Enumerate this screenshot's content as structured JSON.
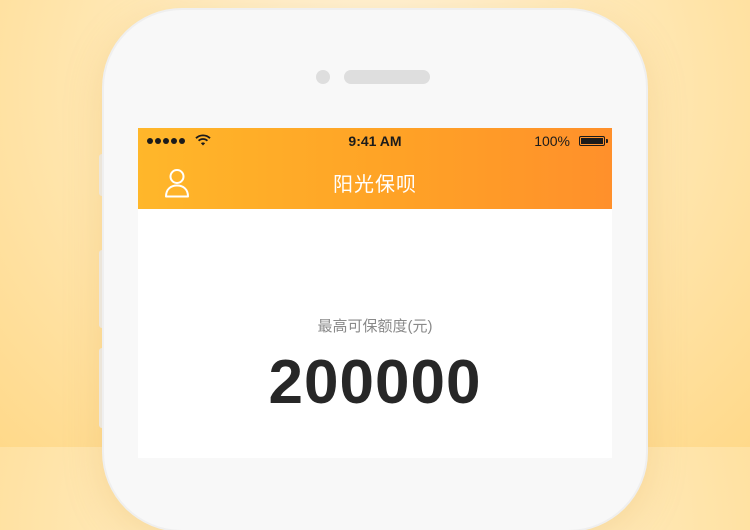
{
  "status_bar": {
    "time": "9:41 AM",
    "battery": "100%",
    "signal_icon": "signal-dots-icon",
    "wifi_icon": "wifi-icon",
    "battery_icon": "battery-icon"
  },
  "header": {
    "title": "阳光保呗",
    "profile_icon": "user-profile-icon",
    "gradient": [
      "#ffb72a",
      "#ff902b"
    ]
  },
  "quota": {
    "label": "最高可保额度(元)",
    "amount": "200000"
  }
}
